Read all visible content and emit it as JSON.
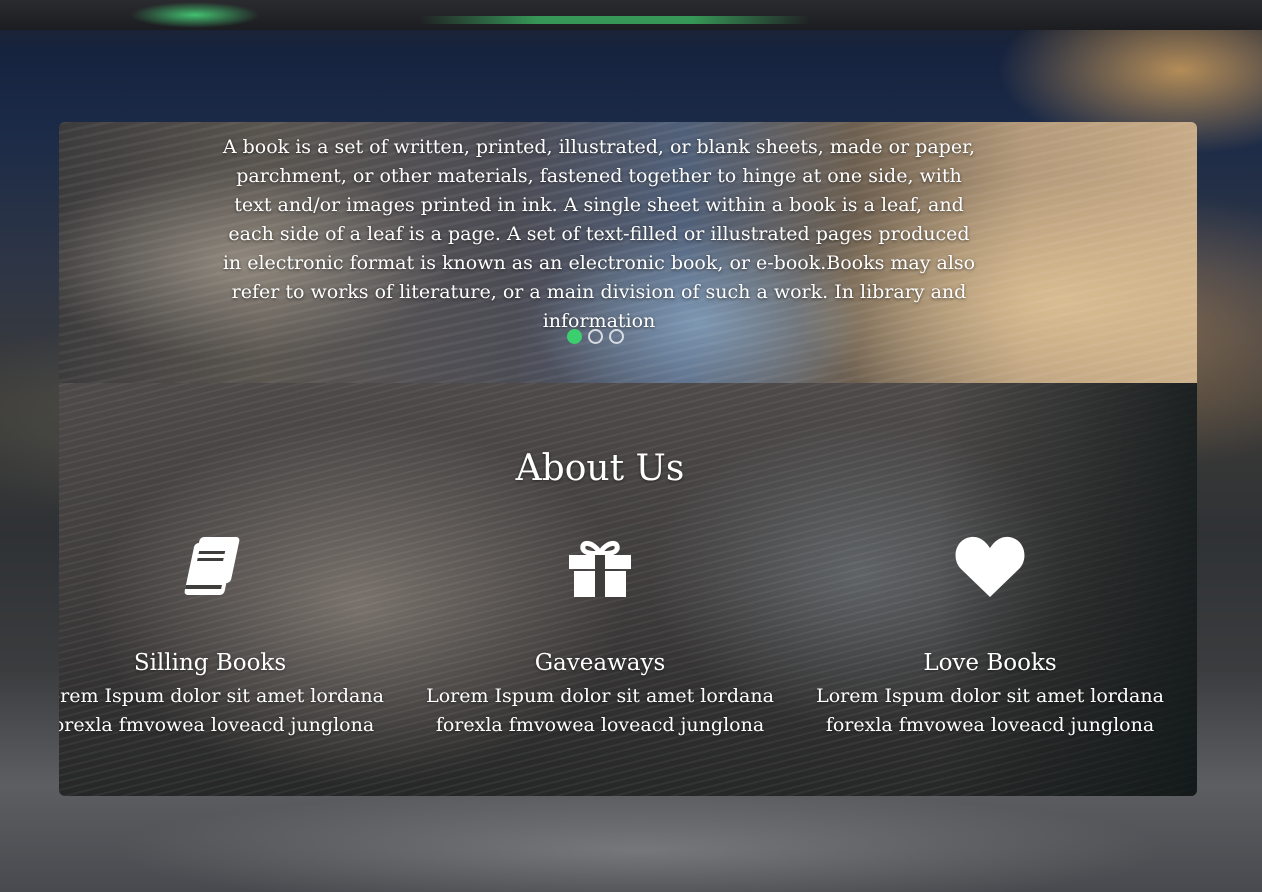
{
  "slider": {
    "text": "A book is a set of written, printed, illustrated, or blank sheets, made or paper, parchment, or other materials, fastened together to hinge at one side, with text and/or images printed in ink. A single sheet within a book is a leaf, and each side of a leaf is a page. A set of text-filled or illustrated pages produced in electronic format is known as an electronic book, or e-book.Books may also refer to works of literature, or a main division of such a work. In library and information",
    "dots": [
      {
        "active": true
      },
      {
        "active": false
      },
      {
        "active": false
      }
    ],
    "active_color": "#3ccf6e"
  },
  "about": {
    "title": "About Us",
    "features": [
      {
        "icon": "book-icon",
        "title": "Silling Books",
        "description": "Lorem Ispum dolor sit amet lordana forexla fmvowea loveacd junglona"
      },
      {
        "icon": "gift-icon",
        "title": "Gaveaways",
        "description": "Lorem Ispum dolor sit amet lordana forexla fmvowea loveacd junglona"
      },
      {
        "icon": "heart-icon",
        "title": "Love Books",
        "description": "Lorem Ispum dolor sit amet lordana forexla fmvowea loveacd junglona"
      }
    ]
  }
}
